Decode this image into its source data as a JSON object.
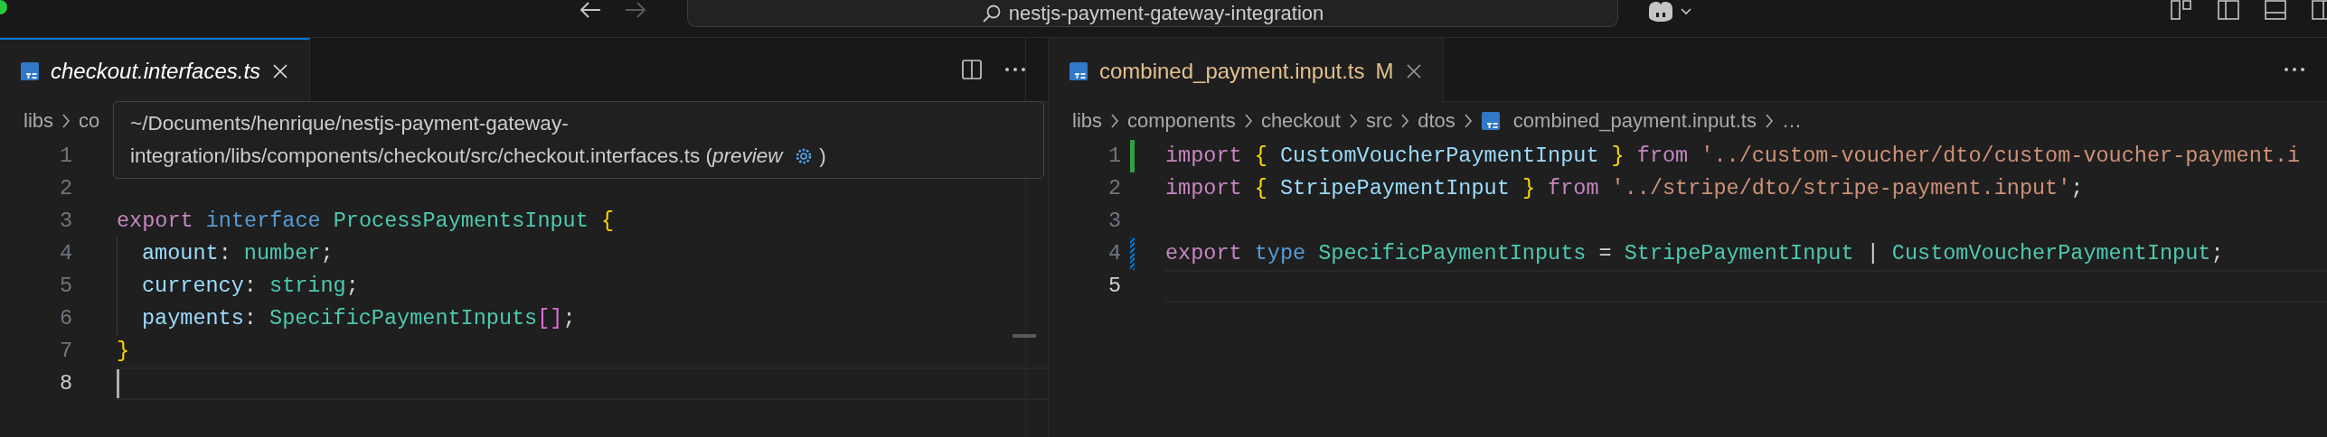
{
  "title_bar": {
    "back_disabled": false,
    "forward_disabled": true,
    "search": "nestjs-payment-gateway-integration"
  },
  "editor_groups": [
    {
      "focused": true,
      "tabs": [
        {
          "label": "checkout.interfaces.ts",
          "selected": true,
          "preview": true
        }
      ],
      "breadcrumb": [
        {
          "label": "libs",
          "kind": "folder"
        },
        {
          "label": "co",
          "kind": "folder"
        }
      ],
      "tooltip": {
        "text": "~/Documents/henrique/nestjs-payment-gateway-integration/libs/components/checkout/src/checkout.interfaces.ts (*preview*",
        "suffix": ")"
      },
      "lines": [
        {
          "number": "1",
          "current": false
        },
        {
          "number": "2",
          "current": false
        },
        {
          "number": "3",
          "current": false,
          "tokens": [
            {
              "text": "export ",
              "kind": "keyword"
            },
            {
              "text": "interface ",
              "kind": "storage"
            },
            {
              "text": "ProcessPaymentsInput ",
              "kind": "type"
            },
            {
              "text": "{",
              "kind": "brace"
            }
          ]
        },
        {
          "number": "4",
          "current": false,
          "indent": true,
          "tokens": [
            {
              "text": "amount",
              "kind": "variable"
            },
            {
              "text": ": ",
              "kind": "punct"
            },
            {
              "text": "number",
              "kind": "type"
            },
            {
              "text": ";",
              "kind": "punct"
            }
          ]
        },
        {
          "number": "5",
          "current": false,
          "indent": true,
          "tokens": [
            {
              "text": "currency",
              "kind": "variable"
            },
            {
              "text": ": ",
              "kind": "punct"
            },
            {
              "text": "string",
              "kind": "type"
            },
            {
              "text": ";",
              "kind": "punct"
            }
          ]
        },
        {
          "number": "6",
          "current": false,
          "indent": true,
          "tokens": [
            {
              "text": "payments",
              "kind": "variable"
            },
            {
              "text": ": ",
              "kind": "punct"
            },
            {
              "text": "SpecificPaymentInputs",
              "kind": "type"
            },
            {
              "text": "[]",
              "kind": "bracket"
            },
            {
              "text": ";",
              "kind": "punct"
            }
          ]
        },
        {
          "number": "7",
          "current": false,
          "tokens": [
            {
              "text": "}",
              "kind": "brace"
            }
          ]
        },
        {
          "number": "8",
          "current": true
        }
      ]
    },
    {
      "focused": false,
      "tabs": [
        {
          "label": "combined_payment.input.ts",
          "selected": true,
          "preview": false,
          "status": "M"
        }
      ],
      "breadcrumb": [
        {
          "label": "libs",
          "kind": "folder"
        },
        {
          "label": "components",
          "kind": "folder"
        },
        {
          "label": "checkout",
          "kind": "folder"
        },
        {
          "label": "src",
          "kind": "folder"
        },
        {
          "label": "dtos",
          "kind": "folder"
        },
        {
          "label": "combined_payment.input.ts",
          "kind": "file"
        },
        {
          "label": "…",
          "kind": "more"
        }
      ],
      "lines": [
        {
          "number": "1",
          "current": false,
          "added": true,
          "modified": false,
          "tokens": [
            {
              "text": "import ",
              "kind": "keyword"
            },
            {
              "text": "{ ",
              "kind": "brace"
            },
            {
              "text": "CustomVoucherPaymentInput",
              "kind": "variable"
            },
            {
              "text": " } ",
              "kind": "brace"
            },
            {
              "text": "from ",
              "kind": "keyword"
            },
            {
              "text": "'../custom-voucher/dto/custom-voucher-payment.i",
              "kind": "string"
            }
          ]
        },
        {
          "number": "2",
          "current": false,
          "added": false,
          "modified": false,
          "tokens": [
            {
              "text": "import ",
              "kind": "keyword"
            },
            {
              "text": "{ ",
              "kind": "brace"
            },
            {
              "text": "StripePaymentInput",
              "kind": "variable"
            },
            {
              "text": " } ",
              "kind": "brace"
            },
            {
              "text": "from ",
              "kind": "keyword"
            },
            {
              "text": "'../stripe/dto/stripe-payment.input'",
              "kind": "string"
            },
            {
              "text": ";",
              "kind": "punct"
            }
          ]
        },
        {
          "number": "3",
          "current": false,
          "added": false,
          "modified": false
        },
        {
          "number": "4",
          "current": false,
          "added": false,
          "modified": true,
          "tokens": [
            {
              "text": "export ",
              "kind": "keyword"
            },
            {
              "text": "type ",
              "kind": "storage"
            },
            {
              "text": "SpecificPaymentInputs",
              "kind": "type"
            },
            {
              "text": " = ",
              "kind": "punct"
            },
            {
              "text": "StripePaymentInput",
              "kind": "type"
            },
            {
              "text": " | ",
              "kind": "punct"
            },
            {
              "text": "CustomVoucherPaymentInput",
              "kind": "type"
            },
            {
              "text": ";",
              "kind": "punct"
            }
          ]
        },
        {
          "number": "5",
          "current": true,
          "added": false,
          "modified": false
        }
      ]
    }
  ]
}
